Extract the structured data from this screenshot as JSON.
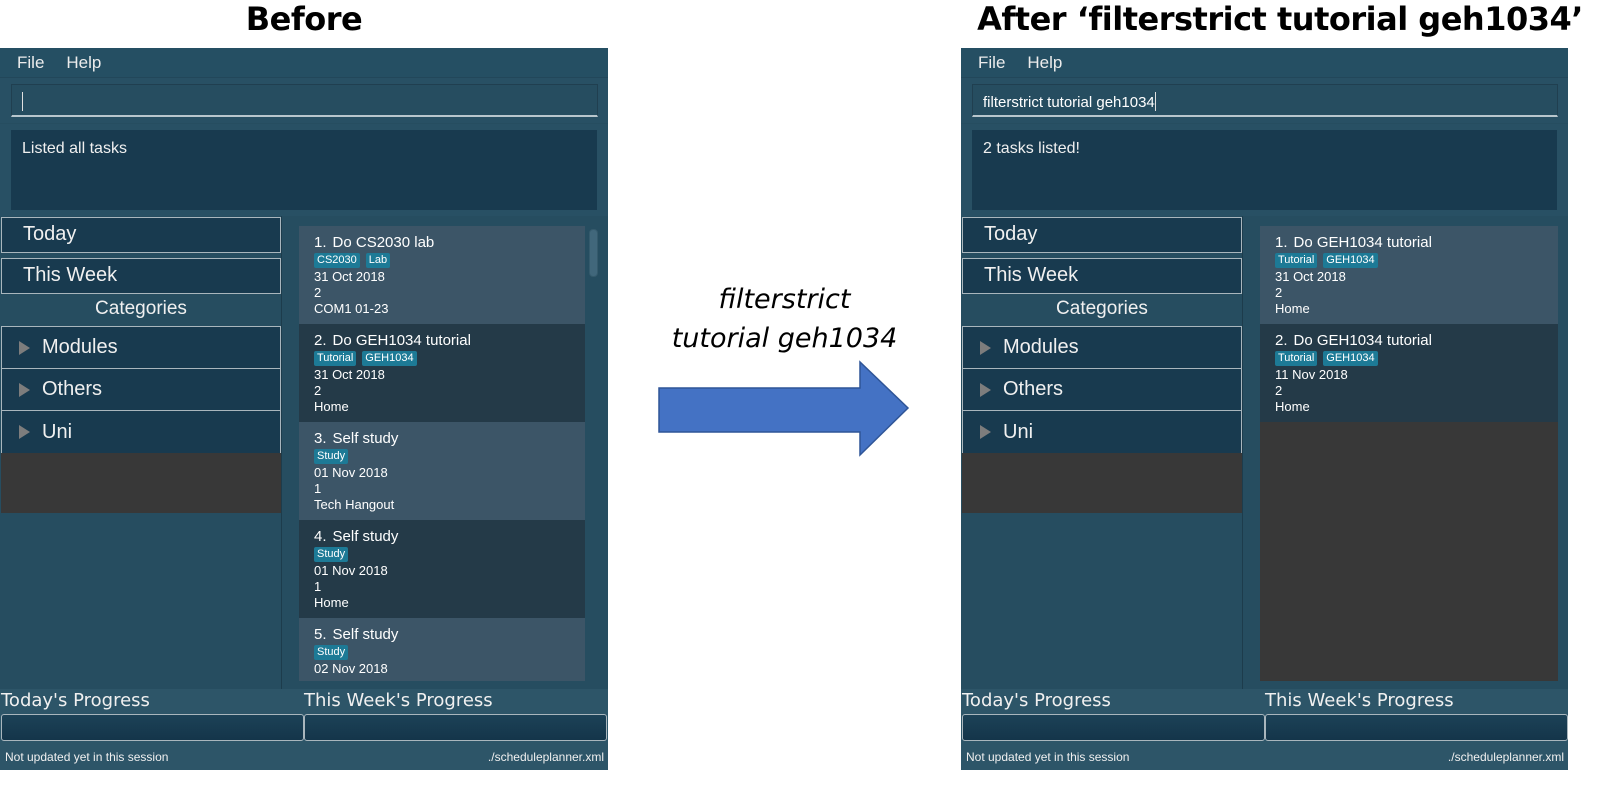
{
  "headings": {
    "before": "Before",
    "after": "After ‘filterstrict tutorial geh1034’"
  },
  "annotation": {
    "command_line1": "filterstrict",
    "command_line2": "tutorial geh1034",
    "arrow_color": "#4472c4",
    "arrow_icon": "right-arrow-icon"
  },
  "colors": {
    "app_background": "#264d60",
    "panel_dark": "#183a4f",
    "tag": "#1d7a96",
    "card_odd": "#3c5567",
    "card_even": "#243a48",
    "empty": "#383838"
  },
  "before": {
    "menu": [
      "File",
      "Help"
    ],
    "command_input": "",
    "result": "Listed all tasks",
    "sidebar": {
      "today": "Today",
      "this_week": "This Week",
      "categories_title": "Categories",
      "categories": [
        "Modules",
        "Others",
        "Uni"
      ]
    },
    "tasks": [
      {
        "index": "1.",
        "title": "Do CS2030 lab",
        "tags": [
          "CS2030",
          "Lab"
        ],
        "date": "31 Oct 2018",
        "priority": "2",
        "venue": "COM1 01-23"
      },
      {
        "index": "2.",
        "title": "Do GEH1034 tutorial",
        "tags": [
          "Tutorial",
          "GEH1034"
        ],
        "date": "31 Oct 2018",
        "priority": "2",
        "venue": "Home"
      },
      {
        "index": "3.",
        "title": "Self study",
        "tags": [
          "Study"
        ],
        "date": "01 Nov 2018",
        "priority": "1",
        "venue": "Tech Hangout"
      },
      {
        "index": "4.",
        "title": "Self study",
        "tags": [
          "Study"
        ],
        "date": "01 Nov 2018",
        "priority": "1",
        "venue": "Home"
      },
      {
        "index": "5.",
        "title": "Self study",
        "tags": [
          "Study"
        ],
        "date": "02 Nov 2018",
        "priority": "",
        "venue": ""
      }
    ],
    "progress": {
      "today_label": "Today's Progress",
      "week_label": "This Week's Progress"
    },
    "status": {
      "sync": "Not updated yet in this session",
      "file": "./scheduleplanner.xml"
    }
  },
  "after": {
    "menu": [
      "File",
      "Help"
    ],
    "command_input": "filterstrict tutorial geh1034",
    "result": "2 tasks listed!",
    "sidebar": {
      "today": "Today",
      "this_week": "This Week",
      "categories_title": "Categories",
      "categories": [
        "Modules",
        "Others",
        "Uni"
      ]
    },
    "tasks": [
      {
        "index": "1.",
        "title": "Do GEH1034 tutorial",
        "tags": [
          "Tutorial",
          "GEH1034"
        ],
        "date": "31 Oct 2018",
        "priority": "2",
        "venue": "Home"
      },
      {
        "index": "2.",
        "title": "Do GEH1034 tutorial",
        "tags": [
          "Tutorial",
          "GEH1034"
        ],
        "date": "11 Nov 2018",
        "priority": "2",
        "venue": "Home"
      }
    ],
    "progress": {
      "today_label": "Today's Progress",
      "week_label": "This Week's Progress"
    },
    "status": {
      "sync": "Not updated yet in this session",
      "file": "./scheduleplanner.xml"
    }
  }
}
